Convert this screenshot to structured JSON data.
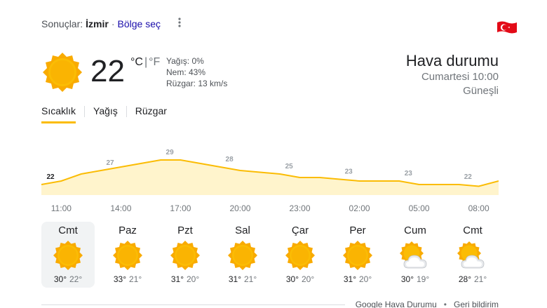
{
  "header": {
    "results_label": "Sonuçlar:",
    "location": "İzmir",
    "separator": "·",
    "region_link": "Bölge seç"
  },
  "icons": {
    "more": "more-vert-icon",
    "flag": "turkey-flag-icon",
    "current": "sun-icon"
  },
  "current": {
    "temperature": "22",
    "unit_c": "°C",
    "unit_sep": "|",
    "unit_f": "°F",
    "precip": "Yağış: 0%",
    "humidity": "Nem: 43%",
    "wind": "Rüzgar: 13 km/s"
  },
  "summary": {
    "title": "Hava durumu",
    "datetime": "Cumartesi 10:00",
    "condition": "Güneşli"
  },
  "tabs": [
    {
      "label": "Sıcaklık",
      "active": true
    },
    {
      "label": "Yağış",
      "active": false
    },
    {
      "label": "Rüzgar",
      "active": false
    }
  ],
  "chart_data": {
    "type": "area",
    "x": [
      "10:00",
      "11:00",
      "12:00",
      "13:00",
      "14:00",
      "15:00",
      "16:00",
      "17:00",
      "18:00",
      "19:00",
      "20:00",
      "21:00",
      "22:00",
      "23:00",
      "00:00",
      "01:00",
      "02:00",
      "03:00",
      "04:00",
      "05:00",
      "06:00",
      "07:00",
      "08:00",
      "09:00"
    ],
    "values": [
      22,
      23,
      25,
      26,
      27,
      28,
      29,
      29,
      28,
      27,
      26,
      25.5,
      25,
      24,
      24,
      23.5,
      23,
      23,
      23,
      22,
      22,
      22,
      21.5,
      23
    ],
    "labels": [
      {
        "index": 0,
        "text": "22"
      },
      {
        "index": 3,
        "text": "27"
      },
      {
        "index": 6,
        "text": "29"
      },
      {
        "index": 9,
        "text": "28"
      },
      {
        "index": 12,
        "text": "25"
      },
      {
        "index": 15,
        "text": "23"
      },
      {
        "index": 18,
        "text": "23"
      },
      {
        "index": 21,
        "text": "22"
      }
    ],
    "ylim": [
      19,
      31
    ],
    "line_color": "#fbbc04",
    "fill_color": "#fff4cc"
  },
  "time_labels": [
    "11:00",
    "14:00",
    "17:00",
    "20:00",
    "23:00",
    "02:00",
    "05:00",
    "08:00"
  ],
  "days": [
    {
      "name": "Cmt",
      "high": "30°",
      "low": "22°",
      "icon": "sun-icon",
      "selected": true
    },
    {
      "name": "Paz",
      "high": "33°",
      "low": "21°",
      "icon": "sun-icon",
      "selected": false
    },
    {
      "name": "Pzt",
      "high": "31°",
      "low": "20°",
      "icon": "sun-icon",
      "selected": false
    },
    {
      "name": "Sal",
      "high": "31°",
      "low": "21°",
      "icon": "sun-icon",
      "selected": false
    },
    {
      "name": "Çar",
      "high": "30°",
      "low": "20°",
      "icon": "sun-icon",
      "selected": false
    },
    {
      "name": "Per",
      "high": "31°",
      "low": "20°",
      "icon": "sun-icon",
      "selected": false
    },
    {
      "name": "Cum",
      "high": "30°",
      "low": "19°",
      "icon": "sun-behind-cloud-icon",
      "selected": false
    },
    {
      "name": "Cmt",
      "high": "28°",
      "low": "21°",
      "icon": "sun-behind-cloud-icon",
      "selected": false
    }
  ],
  "footer": {
    "source": "Google Hava Durumu",
    "dot": "•",
    "feedback": "Geri bildirim"
  },
  "colors": {
    "accent": "#fbbc04",
    "link": "#1a0dab",
    "sun": "#f9a825",
    "selected_bg": "#f1f3f4"
  }
}
